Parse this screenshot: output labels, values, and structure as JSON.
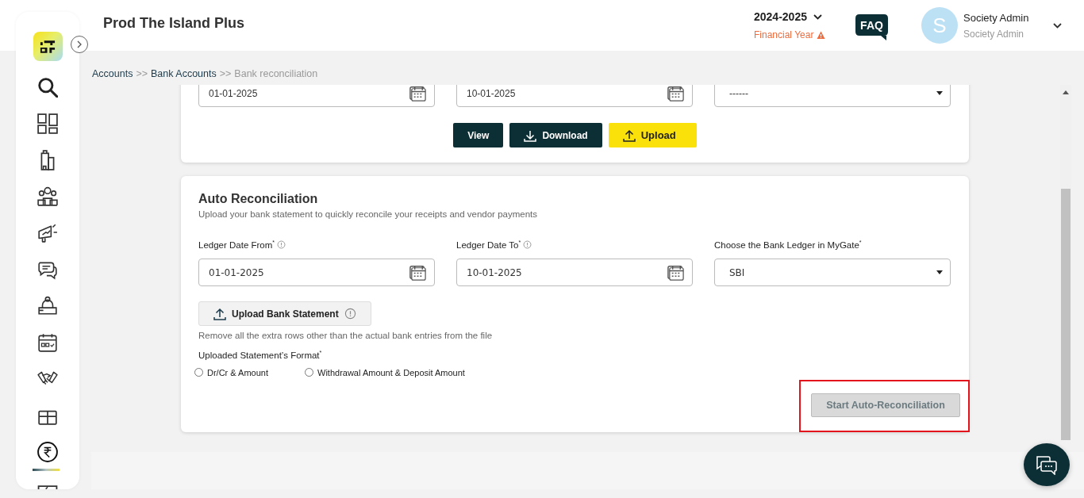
{
  "header": {
    "title": "Prod The Island Plus",
    "year": "2024-2025",
    "year_caption": "Financial Year",
    "faq": "FAQ",
    "avatar_letter": "S",
    "user_name": "Society Admin",
    "user_role": "Society Admin"
  },
  "sidebar": {
    "items": [
      {
        "kind": "search",
        "selected": false
      },
      {
        "kind": "dashboard",
        "selected": false
      },
      {
        "kind": "building",
        "selected": false
      },
      {
        "kind": "people",
        "selected": false
      },
      {
        "kind": "megaphone",
        "selected": false
      },
      {
        "kind": "chat",
        "selected": false
      },
      {
        "kind": "desk",
        "selected": false
      },
      {
        "kind": "calendar",
        "selected": false
      },
      {
        "kind": "handshake",
        "selected": false
      },
      {
        "kind": "gift",
        "selected": false
      },
      {
        "kind": "rupee",
        "selected": true
      },
      {
        "kind": "partial",
        "selected": false
      }
    ]
  },
  "breadcrumb": {
    "items": [
      {
        "label": "Accounts",
        "current": false
      },
      {
        "label": "Bank Accounts",
        "current": false
      },
      {
        "label": "Bank reconciliation",
        "current": true
      }
    ],
    "separators": [
      ">>",
      ">>"
    ]
  },
  "filter_card": {
    "fields": [
      {
        "kind": "date",
        "value": "01-01-2025"
      },
      {
        "kind": "date",
        "value": "10-01-2025"
      },
      {
        "kind": "select",
        "value": "------"
      }
    ],
    "buttons": [
      {
        "kind": "plain",
        "label": "View"
      },
      {
        "kind": "download",
        "label": "Download"
      },
      {
        "kind": "upload",
        "label": "Upload"
      }
    ]
  },
  "auto_card": {
    "title": "Auto Reconciliation",
    "subtitle": "Upload your bank statement to quickly reconcile your receipts and vendor payments",
    "fields": [
      {
        "kind": "date",
        "label": "Ledger Date From$^{*}$",
        "info": true,
        "value": "01-01-2025"
      },
      {
        "kind": "date",
        "label": "Ledger Date To$^{*}$",
        "info": true,
        "value": "10-01-2025"
      },
      {
        "kind": "select",
        "label": "Choose the Bank Ledger in MyGate$^{*}$",
        "info": false,
        "value": "SBI"
      }
    ],
    "upload_button": "Upload Bank Statement",
    "hint": "Remove all the extra rows other than the actual bank entries from the file",
    "format_label": "Uploaded Statement’s Format$^{*}$",
    "formats": [
      {
        "label": "Dr/Cr & Amount",
        "selected": false
      },
      {
        "label": "Withdrawal Amount & Deposit Amount",
        "selected": false
      }
    ],
    "start_button": {
      "label": "Start Auto-Reconciliation",
      "disabled": true
    },
    "highlighted": true
  }
}
